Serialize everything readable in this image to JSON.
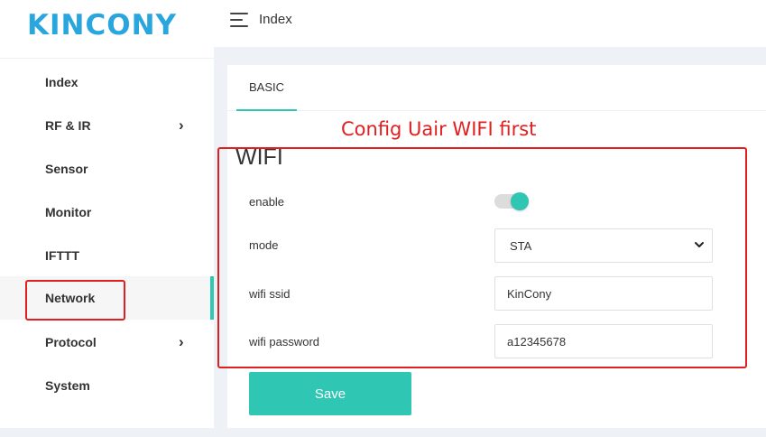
{
  "brand": {
    "logo_text": "KINCONY",
    "logo_color": "#2aa6df"
  },
  "header": {
    "title": "Index"
  },
  "sidebar": {
    "items": [
      {
        "label": "Index",
        "has_submenu": false
      },
      {
        "label": "RF & IR",
        "has_submenu": true
      },
      {
        "label": "Sensor",
        "has_submenu": false
      },
      {
        "label": "Monitor",
        "has_submenu": false
      },
      {
        "label": "IFTTT",
        "has_submenu": false
      },
      {
        "label": "Network",
        "has_submenu": false,
        "active": true
      },
      {
        "label": "Protocol",
        "has_submenu": true
      },
      {
        "label": "System",
        "has_submenu": false
      }
    ],
    "chevron_glyph": "›"
  },
  "tabs": [
    {
      "label": "BASIC",
      "active": true
    }
  ],
  "annotation": {
    "text": "Config Uair WIFI first",
    "color": "#e02020"
  },
  "wifi": {
    "title": "WIFI",
    "enable_label": "enable",
    "enable_value": true,
    "mode_label": "mode",
    "mode_value": "STA",
    "ssid_label": "wifi ssid",
    "ssid_value": "KinCony",
    "password_label": "wifi password",
    "password_value": "a12345678"
  },
  "actions": {
    "save_label": "Save"
  },
  "colors": {
    "accent": "#2fc6b4",
    "annotation": "#e02020",
    "background": "#eef1f5"
  }
}
